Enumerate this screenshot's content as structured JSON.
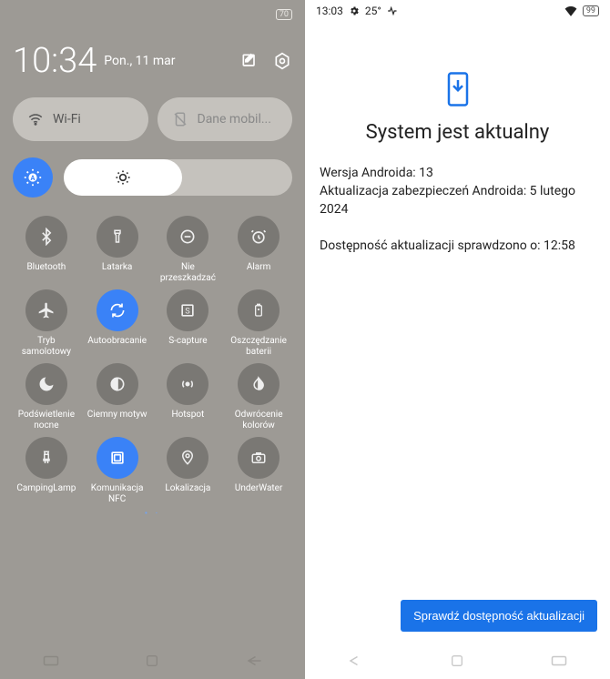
{
  "left": {
    "battery": "70",
    "time": "10:34",
    "date": "Pon., 11 mar",
    "wifi_label": "Wi-Fi",
    "data_label": "Dane mobil...",
    "tiles": [
      {
        "label": "Bluetooth"
      },
      {
        "label": "Latarka"
      },
      {
        "label": "Nie przeszkadzać"
      },
      {
        "label": "Alarm"
      },
      {
        "label": "Tryb samolotowy"
      },
      {
        "label": "Autoobracanie"
      },
      {
        "label": "S-capture"
      },
      {
        "label": "Oszczędzanie baterii"
      },
      {
        "label": "Podświetlenie nocne"
      },
      {
        "label": "Ciemny motyw"
      },
      {
        "label": "Hotspot"
      },
      {
        "label": "Odwrócenie kolorów"
      },
      {
        "label": "CampingLamp"
      },
      {
        "label": "Komunikacja NFC"
      },
      {
        "label": "Lokalizacja"
      },
      {
        "label": "UnderWater"
      }
    ]
  },
  "right": {
    "status_time": "13:03",
    "temp": "25°",
    "battery": "99",
    "title": "System jest aktualny",
    "line1": "Wersja Androida: 13",
    "line2": "Aktualizacja zabezpieczeń Androida: 5 lutego 2024",
    "line3": "Dostępność aktualizacji sprawdzono o: 12:58",
    "button": "Sprawdź dostępność aktualizacji"
  }
}
